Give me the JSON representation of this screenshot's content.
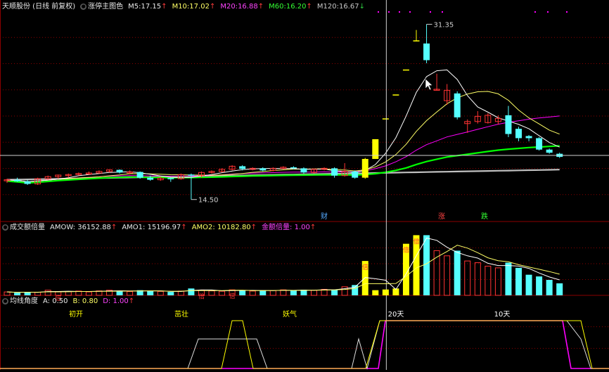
{
  "colors": {
    "bg": "#000000",
    "grid": "#8b0000",
    "up": "#ff3333",
    "down": "#55ffff",
    "yellow": "#ffff00",
    "white": "#ffffff",
    "magenta": "#ff00ff",
    "green": "#00ff00",
    "gray": "#c0c0c0",
    "ma_yellow": "#ffff66"
  },
  "panel1": {
    "stock_name": "天顺股份 (日线 前复权)",
    "indicator_name": "涨停主图色",
    "ma": [
      {
        "label": "M5:",
        "value": "17.15",
        "arrow": "↑",
        "color": "#e8e8e8"
      },
      {
        "label": "M10:",
        "value": "17.02",
        "arrow": "↑",
        "color": "#ffff66"
      },
      {
        "label": "M20:",
        "value": "16.88",
        "arrow": "↑",
        "color": "#ff44ff"
      },
      {
        "label": "M60:",
        "value": "16.20",
        "arrow": "↑",
        "color": "#33ff33"
      },
      {
        "label": "M120:",
        "value": "16.67",
        "arrow": "↓",
        "color": "#c8c8c8"
      }
    ],
    "high_label": "31.35",
    "low_label": "14.50",
    "event_markers": [
      "财",
      "涨",
      "跌"
    ]
  },
  "panel2": {
    "name": "成交额倍量",
    "items": [
      {
        "label": "AMOW:",
        "value": "36152.88",
        "arrow": "↑",
        "color": "#e8e8e8"
      },
      {
        "label": "AMO1:",
        "value": "15196.97",
        "arrow": "↑",
        "color": "#e8e8e8"
      },
      {
        "label": "AMO2:",
        "value": "10182.80",
        "arrow": "↑",
        "color": "#ffff66"
      },
      {
        "label": "金额倍量:",
        "value": "1.00",
        "arrow": "↑",
        "color": "#ff44ff"
      }
    ],
    "bar_marker": "倍"
  },
  "panel3": {
    "name": "均线角度",
    "items": [
      {
        "label": "A:",
        "value": "0.50",
        "color": "#e8e8e8"
      },
      {
        "label": "B:",
        "value": "0.80",
        "color": "#ffff66"
      },
      {
        "label": "D:",
        "value": "1.00",
        "arrow": "↑",
        "color": "#ff44ff"
      }
    ],
    "labels": [
      "初开",
      "茁壮",
      "妖气",
      "20天",
      "10天"
    ]
  },
  "candles": [
    {
      "o": 16.3,
      "h": 16.5,
      "l": 16.1,
      "c": 16.4
    },
    {
      "o": 16.4,
      "h": 16.6,
      "l": 16.2,
      "c": 16.25
    },
    {
      "o": 16.25,
      "h": 16.4,
      "l": 15.9,
      "c": 16.0
    },
    {
      "o": 16.0,
      "h": 16.6,
      "l": 15.9,
      "c": 16.5
    },
    {
      "o": 16.5,
      "h": 16.8,
      "l": 16.4,
      "c": 16.7
    },
    {
      "o": 16.7,
      "h": 16.9,
      "l": 16.5,
      "c": 16.85
    },
    {
      "o": 16.85,
      "h": 17.0,
      "l": 16.6,
      "c": 16.9
    },
    {
      "o": 16.9,
      "h": 17.1,
      "l": 16.8,
      "c": 17.0
    },
    {
      "o": 17.0,
      "h": 17.2,
      "l": 16.9,
      "c": 17.05
    },
    {
      "o": 17.05,
      "h": 17.3,
      "l": 17.0,
      "c": 17.2
    },
    {
      "o": 17.2,
      "h": 17.4,
      "l": 17.1,
      "c": 17.35
    },
    {
      "o": 17.35,
      "h": 17.4,
      "l": 17.0,
      "c": 17.1
    },
    {
      "o": 17.1,
      "h": 17.3,
      "l": 16.9,
      "c": 17.15
    },
    {
      "o": 17.15,
      "h": 17.2,
      "l": 16.5,
      "c": 16.6
    },
    {
      "o": 16.6,
      "h": 16.8,
      "l": 16.3,
      "c": 16.4
    },
    {
      "o": 16.4,
      "h": 16.7,
      "l": 16.3,
      "c": 16.55
    },
    {
      "o": 16.55,
      "h": 16.6,
      "l": 16.2,
      "c": 16.5
    },
    {
      "o": 16.5,
      "h": 17.0,
      "l": 16.4,
      "c": 16.9
    },
    {
      "o": 16.9,
      "h": 17.0,
      "l": 14.5,
      "c": 16.8
    },
    {
      "o": 16.8,
      "h": 17.2,
      "l": 16.6,
      "c": 17.1
    },
    {
      "o": 17.1,
      "h": 17.3,
      "l": 17.0,
      "c": 17.2
    },
    {
      "o": 17.2,
      "h": 17.5,
      "l": 17.1,
      "c": 17.4
    },
    {
      "o": 17.4,
      "h": 17.8,
      "l": 17.3,
      "c": 17.7
    },
    {
      "o": 17.7,
      "h": 17.8,
      "l": 17.3,
      "c": 17.45
    },
    {
      "o": 17.45,
      "h": 17.6,
      "l": 17.3,
      "c": 17.5
    },
    {
      "o": 17.5,
      "h": 17.6,
      "l": 17.2,
      "c": 17.3
    },
    {
      "o": 17.3,
      "h": 17.6,
      "l": 17.2,
      "c": 17.5
    },
    {
      "o": 17.5,
      "h": 17.7,
      "l": 17.4,
      "c": 17.6
    },
    {
      "o": 17.6,
      "h": 17.7,
      "l": 17.4,
      "c": 17.5
    },
    {
      "o": 17.5,
      "h": 17.6,
      "l": 17.0,
      "c": 17.1
    },
    {
      "o": 17.1,
      "h": 17.5,
      "l": 17.0,
      "c": 17.4
    },
    {
      "o": 17.4,
      "h": 17.6,
      "l": 17.3,
      "c": 17.5
    },
    {
      "o": 17.5,
      "h": 17.6,
      "l": 16.6,
      "c": 16.8
    },
    {
      "o": 16.8,
      "h": 18.0,
      "l": 16.7,
      "c": 17.2
    },
    {
      "o": 17.2,
      "h": 17.3,
      "l": 16.5,
      "c": 16.6
    },
    {
      "o": 16.6,
      "h": 18.5,
      "l": 16.5,
      "c": 18.4,
      "lim": true
    },
    {
      "o": 18.4,
      "h": 20.3,
      "l": 18.4,
      "c": 20.3,
      "lim": true
    },
    {
      "o": 22.3,
      "h": 22.3,
      "l": 22.3,
      "c": 22.3,
      "lim": true
    },
    {
      "o": 24.6,
      "h": 24.6,
      "l": 24.6,
      "c": 24.6,
      "lim": true
    },
    {
      "o": 27.0,
      "h": 27.0,
      "l": 27.0,
      "c": 27.0,
      "lim": true
    },
    {
      "o": 29.8,
      "h": 30.8,
      "l": 29.7,
      "c": 29.8,
      "lim": true
    },
    {
      "o": 29.5,
      "h": 31.35,
      "l": 27.6,
      "c": 27.9
    },
    {
      "o": 25.1,
      "h": 26.6,
      "l": 25.0,
      "c": 25.1
    },
    {
      "o": 24.0,
      "h": 25.6,
      "l": 23.6,
      "c": 25.0
    },
    {
      "o": 24.7,
      "h": 24.9,
      "l": 22.2,
      "c": 22.4
    },
    {
      "o": 21.8,
      "h": 22.2,
      "l": 20.9,
      "c": 22.0
    },
    {
      "o": 22.0,
      "h": 23.0,
      "l": 21.8,
      "c": 22.5
    },
    {
      "o": 21.9,
      "h": 22.8,
      "l": 21.8,
      "c": 22.6
    },
    {
      "o": 22.0,
      "h": 22.6,
      "l": 21.7,
      "c": 22.3
    },
    {
      "o": 22.6,
      "h": 23.5,
      "l": 20.5,
      "c": 20.8
    },
    {
      "o": 21.3,
      "h": 21.5,
      "l": 20.1,
      "c": 20.4
    },
    {
      "o": 20.6,
      "h": 20.7,
      "l": 20.1,
      "c": 20.4
    },
    {
      "o": 20.4,
      "h": 20.5,
      "l": 19.2,
      "c": 19.3
    },
    {
      "o": 19.3,
      "h": 19.4,
      "l": 18.9,
      "c": 19.0
    },
    {
      "o": 18.9,
      "h": 19.0,
      "l": 18.5,
      "c": 18.6
    }
  ],
  "volume": [
    2,
    1.5,
    2,
    1.8,
    3,
    2,
    2.2,
    2.5,
    2,
    2.6,
    3,
    2.4,
    2.2,
    3,
    2.6,
    2.3,
    2,
    2.5,
    4,
    3,
    2.6,
    2.4,
    3.2,
    3,
    2.5,
    3,
    2.8,
    3.2,
    2.7,
    3.3,
    3,
    3.5,
    3.2,
    5,
    6,
    20,
    3,
    3.4,
    4,
    30,
    35,
    35,
    26,
    23,
    26,
    20,
    19,
    17,
    16,
    19,
    16,
    12,
    11,
    9,
    7
  ]
}
